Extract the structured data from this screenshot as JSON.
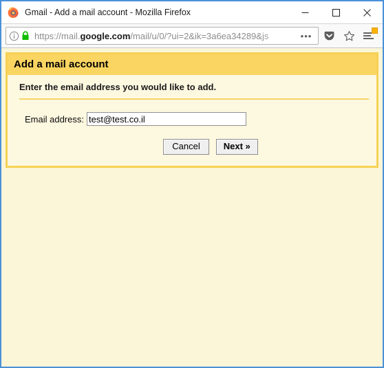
{
  "window": {
    "title": "Gmail - Add a mail account - Mozilla Firefox",
    "app_icon": "firefox-logo-icon",
    "controls": {
      "minimize_label": "Minimize",
      "maximize_label": "Maximize",
      "close_label": "Close"
    },
    "border_color": "#4a90d9"
  },
  "navbar": {
    "identity_icon": "info-circle-icon",
    "security_icon": "green-padlock-icon",
    "url_scheme": "https://mail.",
    "url_domain": "google.com",
    "url_path": "/mail/u/0/?ui=2&ik=3a6ea34289&js",
    "url_full": "https://mail.google.com/mail/u/0/?ui=2&ik=3a6ea34289&js",
    "page_actions_label": "•••",
    "pocket_icon": "pocket-icon",
    "bookmark_icon": "star-bookmark-icon",
    "menu_icon": "hamburger-menu-icon",
    "menu_badge": "update-available-badge"
  },
  "dialog": {
    "title": "Add a mail account",
    "subtitle": "Enter the email address you would like to add.",
    "field": {
      "label": "Email address:",
      "value": "test@test.co.il",
      "placeholder": ""
    },
    "buttons": {
      "cancel": "Cancel",
      "next": "Next »"
    },
    "colors": {
      "border": "#f7d154",
      "header_bg": "#fad561",
      "body_bg": "#fdf8e0",
      "page_bg": "#fcf6d9",
      "rule": "#f5d468"
    }
  }
}
